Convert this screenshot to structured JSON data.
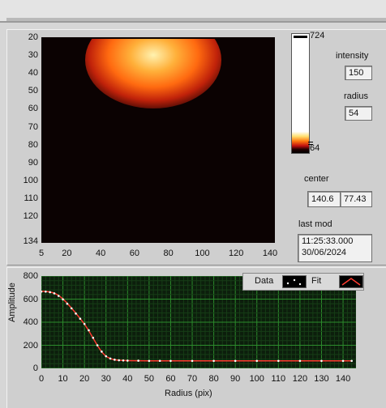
{
  "image_panel": {
    "y_ticks": [
      "20",
      "30",
      "40",
      "50",
      "60",
      "70",
      "80",
      "90",
      "100",
      "110",
      "120",
      "134"
    ],
    "x_ticks": [
      "5",
      "20",
      "40",
      "60",
      "80",
      "100",
      "120",
      "140"
    ]
  },
  "colorbar": {
    "max_label": "724",
    "min_label": "64"
  },
  "controls": {
    "intensity_label": "intensity",
    "intensity_value": "150",
    "radius_label": "radius",
    "radius_value": "54",
    "center_label": "center",
    "center_x": "140.6",
    "center_y": "77.43",
    "last_mod_label": "last mod",
    "last_mod_time": "11:25:33.000",
    "last_mod_date": "30/06/2024"
  },
  "legend": {
    "data_label": "Data",
    "fit_label": "Fit"
  },
  "colors": {
    "fit_line": "#ff3b30",
    "data_points": "#ffffff",
    "grid": "#1f7a1f",
    "plot_bg": "#0c1e0c"
  },
  "chart_data": {
    "type": "line",
    "xlabel": "Radius (pix)",
    "ylabel": "Amplitude",
    "xlim": [
      0,
      146
    ],
    "ylim": [
      0,
      800
    ],
    "x_ticks": [
      "0",
      "10",
      "20",
      "30",
      "40",
      "50",
      "60",
      "70",
      "80",
      "90",
      "100",
      "110",
      "120",
      "130",
      "140"
    ],
    "y_ticks": [
      "0",
      "200",
      "400",
      "600",
      "800"
    ],
    "grid": true,
    "legend_position": "top-right",
    "series": [
      {
        "name": "Data",
        "x": [
          0,
          2,
          4,
          6,
          8,
          10,
          12,
          14,
          16,
          18,
          20,
          22,
          24,
          26,
          28,
          30,
          32,
          34,
          36,
          38,
          40,
          45,
          50,
          55,
          60,
          70,
          80,
          90,
          100,
          110,
          120,
          130,
          140,
          144
        ],
        "y": [
          665,
          665,
          660,
          650,
          628,
          598,
          560,
          520,
          475,
          430,
          385,
          330,
          265,
          200,
          145,
          105,
          85,
          75,
          70,
          68,
          67,
          66,
          65,
          65,
          65,
          65,
          65,
          65,
          65,
          65,
          65,
          65,
          65,
          65
        ]
      },
      {
        "name": "Fit",
        "x": [
          0,
          2,
          4,
          6,
          8,
          10,
          12,
          14,
          16,
          18,
          20,
          22,
          24,
          26,
          28,
          30,
          32,
          34,
          36,
          38,
          40,
          45,
          50,
          55,
          60,
          70,
          80,
          90,
          100,
          110,
          120,
          130,
          140,
          144
        ],
        "y": [
          668,
          667,
          662,
          652,
          632,
          602,
          564,
          522,
          478,
          432,
          384,
          326,
          262,
          198,
          142,
          104,
          84,
          74,
          70,
          68,
          67,
          66,
          65,
          65,
          65,
          65,
          65,
          65,
          65,
          65,
          65,
          65,
          65,
          65
        ]
      }
    ]
  }
}
